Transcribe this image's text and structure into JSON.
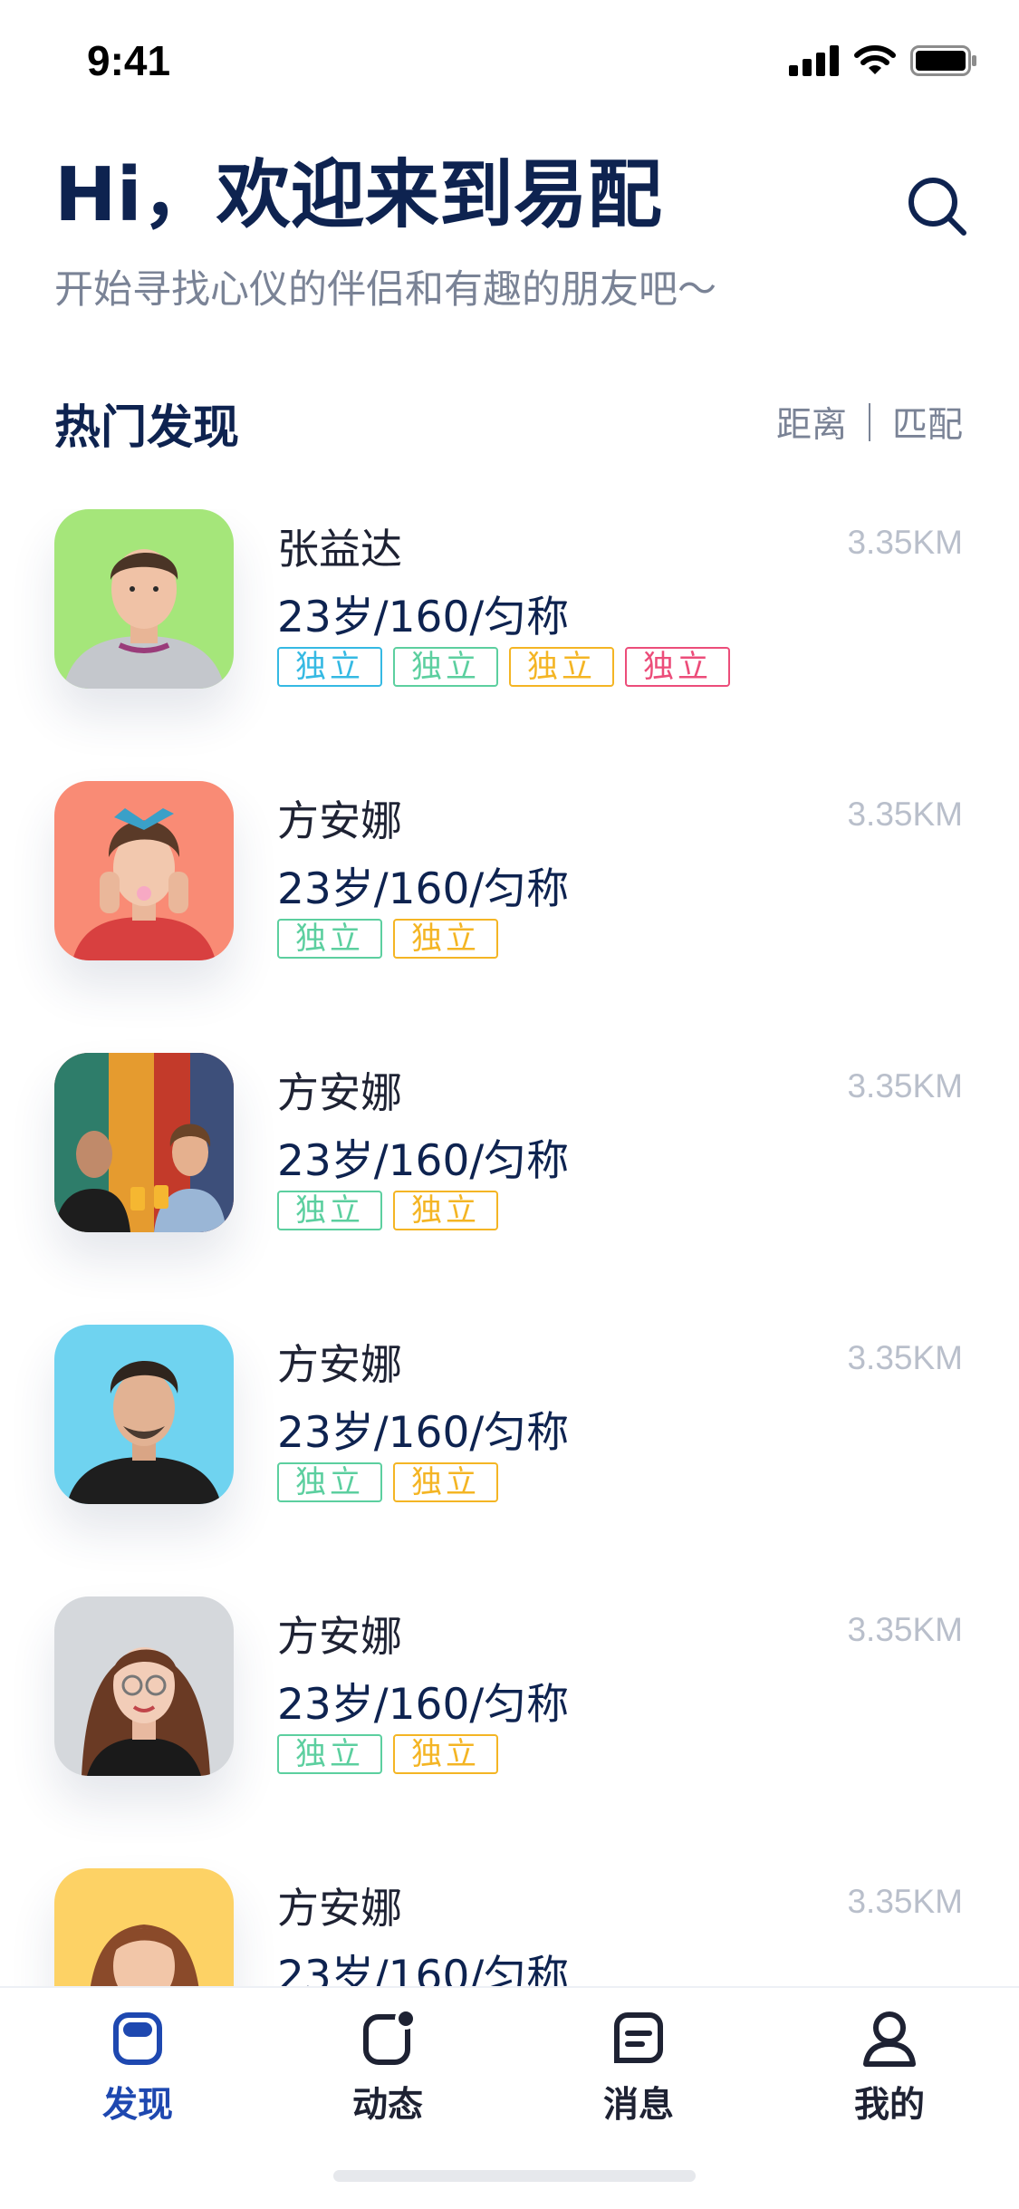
{
  "status_bar": {
    "time": "9:41"
  },
  "header": {
    "greeting": "Hi，欢迎来到易配",
    "subtitle": "开始寻找心仪的伴侣和有趣的朋友吧～",
    "search_icon": "search-icon"
  },
  "section": {
    "title": "热门发现",
    "sort_options": [
      "距离",
      "匹配"
    ]
  },
  "tag_colors": {
    "blue": "#35b9e3",
    "green": "#5ccf9f",
    "orange": "#f4b524",
    "red": "#ec4d7a"
  },
  "users": [
    {
      "name": "张益达",
      "meta": "23岁/160/匀称",
      "distance": "3.35KM",
      "tags": [
        {
          "label": "独立",
          "color": "blue"
        },
        {
          "label": "独立",
          "color": "green"
        },
        {
          "label": "独立",
          "color": "orange"
        },
        {
          "label": "独立",
          "color": "red"
        }
      ]
    },
    {
      "name": "方安娜",
      "meta": "23岁/160/匀称",
      "distance": "3.35KM",
      "tags": [
        {
          "label": "独立",
          "color": "green"
        },
        {
          "label": "独立",
          "color": "orange"
        }
      ]
    },
    {
      "name": "方安娜",
      "meta": "23岁/160/匀称",
      "distance": "3.35KM",
      "tags": [
        {
          "label": "独立",
          "color": "green"
        },
        {
          "label": "独立",
          "color": "orange"
        }
      ]
    },
    {
      "name": "方安娜",
      "meta": "23岁/160/匀称",
      "distance": "3.35KM",
      "tags": [
        {
          "label": "独立",
          "color": "green"
        },
        {
          "label": "独立",
          "color": "orange"
        }
      ]
    },
    {
      "name": "方安娜",
      "meta": "23岁/160/匀称",
      "distance": "3.35KM",
      "tags": [
        {
          "label": "独立",
          "color": "green"
        },
        {
          "label": "独立",
          "color": "orange"
        }
      ]
    },
    {
      "name": "方安娜",
      "meta": "23岁/160/匀称",
      "distance": "3.35KM",
      "tags": []
    }
  ],
  "tab_bar": {
    "tabs": [
      {
        "label": "发现",
        "icon": "discover-icon",
        "active": true
      },
      {
        "label": "动态",
        "icon": "moments-icon",
        "active": false
      },
      {
        "label": "消息",
        "icon": "message-icon",
        "active": false
      },
      {
        "label": "我的",
        "icon": "profile-icon",
        "active": false
      }
    ],
    "active_color": "#1e48b0"
  }
}
